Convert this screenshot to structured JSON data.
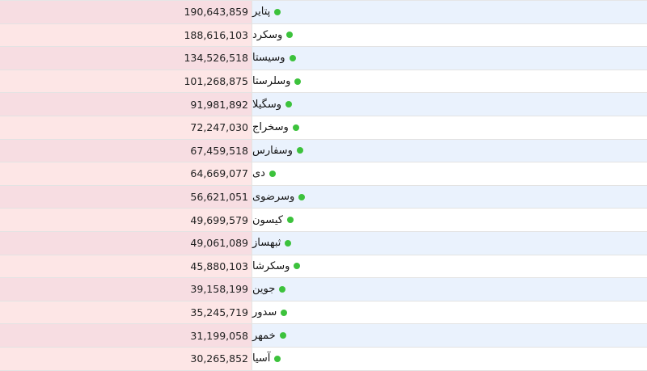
{
  "colors": {
    "status_dot": "#3cc23c"
  },
  "table": {
    "rows": [
      {
        "name": "پتایر",
        "value": "190,643,859"
      },
      {
        "name": "وسکرد",
        "value": "188,616,103"
      },
      {
        "name": "وسیستا",
        "value": "134,526,518"
      },
      {
        "name": "وسلرستا",
        "value": "101,268,875"
      },
      {
        "name": "وسگیلا",
        "value": "91,981,892"
      },
      {
        "name": "وسخراج",
        "value": "72,247,030"
      },
      {
        "name": "وسفارس",
        "value": "67,459,518"
      },
      {
        "name": "دی",
        "value": "64,669,077"
      },
      {
        "name": "وسرضوی",
        "value": "56,621,051"
      },
      {
        "name": "کیسون",
        "value": "49,699,579"
      },
      {
        "name": "ثبهساز",
        "value": "49,061,089"
      },
      {
        "name": "وسکرشا",
        "value": "45,880,103"
      },
      {
        "name": "جوین",
        "value": "39,158,199"
      },
      {
        "name": "سدور",
        "value": "35,245,719"
      },
      {
        "name": "خمهر",
        "value": "31,199,058"
      },
      {
        "name": "آسیا",
        "value": "30,265,852"
      }
    ]
  }
}
